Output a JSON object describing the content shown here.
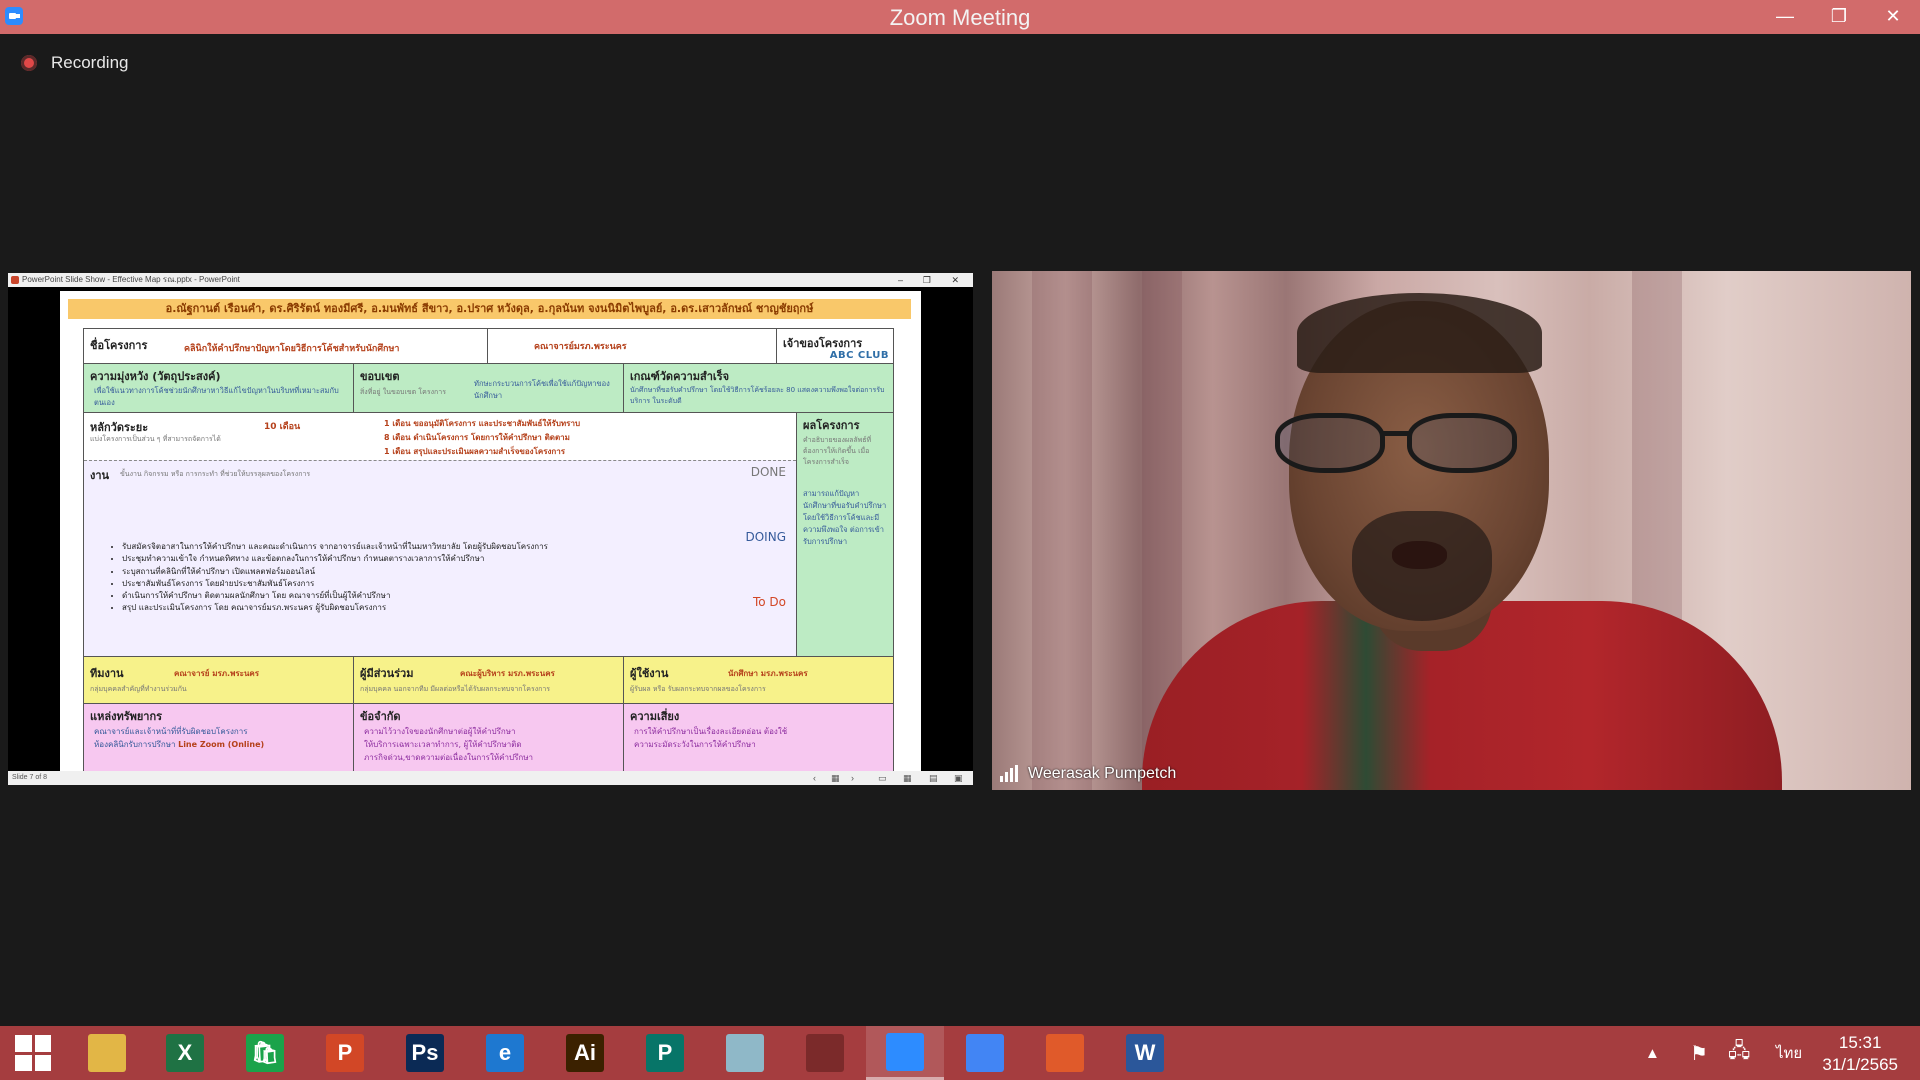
{
  "window": {
    "title": "Zoom Meeting",
    "controls": {
      "minimize": "—",
      "maximize": "❐",
      "close": "✕"
    },
    "brand_color": "#d26b6b"
  },
  "recording": {
    "label": "Recording"
  },
  "share": {
    "powerpoint_title": "PowerPoint Slide Show - Effective Map รณ.pptx - PowerPoint",
    "status_left": "Slide 7 of 8",
    "slide": {
      "header": "อ.ณัฐกานต์ เรือนคำ, ดร.ศิริรัตน์ ทองมีศรี, อ.มนพัทธ์ สีขาว, อ.ปราศ หวังดุล, อ.กุลนันท จงนนิมิตไพบูลย์, อ.ดร.เสาวลักษณ์ ชาญชัยฤกษ์",
      "project_name": {
        "label": "ชื่อโครงการ",
        "value": "คลินิกให้คำปรึกษาปัญหาโดยวิธีการโค้ชสำหรับนักศึกษา"
      },
      "owner_value": "คณาจารย์มรภ.พระนคร",
      "project_owner": {
        "label": "เจ้าของโครงการ",
        "logo": "ABC CLUB"
      },
      "objective": {
        "label": "ความมุ่งหวัง (วัตถุประสงค์)",
        "text": "เพื่อใช้แนวทางการโค้ชช่วยนักศึกษาหาวิธีแก้ไขปัญหาในบริบทที่เหมาะสมกับตนเอง"
      },
      "scope": {
        "label": "ขอบเขต",
        "sub": "สิ่งที่อยู่ ในขอบเขต โครงการ",
        "text": "ทักษะกระบวนการโค้ชเพื่อใช้แก้ปัญหาของนักศึกษา"
      },
      "success_criteria": {
        "label": "เกณฑ์วัดความสำเร็จ",
        "text": "นักศึกษาที่ขอรับคำปรึกษา โดยใช้วิธีการโค้ชร้อยละ 80 แสดงความพึงพอใจต่อการรับบริการ ในระดับดี"
      },
      "milestones": {
        "label": "หลักวัดระยะ",
        "sub": "แบ่งโครงการเป็นส่วน ๆ ที่สามารถจัดการได้",
        "duration": "10 เดือน",
        "items": [
          "1 เดือน ขออนุมัติโครงการ และประชาสัมพันธ์ให้รับทราบ",
          "8 เดือน ดำเนินโครงการ โดยการให้คำปรึกษา ติดตาม",
          "1 เดือน สรุปและประเมินผลความสำเร็จของโครงการ"
        ]
      },
      "tasks": {
        "label": "งาน",
        "sub": "ขั้นงาน กิจกรรม หรือ การกระทำ ที่ช่วยให้บรรลุผลของโครงการ",
        "done": "DONE",
        "doing": "DOING",
        "todo": "To Do",
        "bullets": [
          "รับสมัครจิตอาสาในการให้คำปรึกษา และคณะดำเนินการ จากอาจารย์และเจ้าหน้าที่ในมหาวิทยาลัย โดยผู้รับผิดชอบโครงการ",
          "ประชุมทำความเข้าใจ กำหนดทิศทาง และข้อตกลงในการให้คำปรึกษา กำหนดตารางเวลาการให้คำปรึกษา",
          "ระบุสถานที่คลินิกที่ให้คำปรึกษา เปิดแพลตฟอร์มออนไลน์",
          "ประชาสัมพันธ์โครงการ โดยฝ่ายประชาสัมพันธ์โครงการ",
          "ดำเนินการให้คำปรึกษา ติดตามผลนักศึกษา โดย คณาจารย์ที่เป็นผู้ให้คำปรึกษา",
          "สรุป และประเมินโครงการ โดย คณาจารย์มรภ.พระนคร ผู้รับผิดชอบโครงการ"
        ]
      },
      "outcome": {
        "label": "ผลโครงการ",
        "sub": "คำอธิบายของผลลัพธ์ที่ต้องการให้เกิดขึ้น เมื่อโครงการสำเร็จ",
        "text": "สามารถแก้ปัญหานักศึกษาที่ขอรับคำปรึกษา โดยใช้วิธีการโค้ชและมีความพึงพอใจ ต่อการเข้ารับการปรึกษา"
      },
      "team": {
        "label": "ทีมงาน",
        "value": "คณาจารย์ มรภ.พระนคร",
        "sub": "กลุ่มบุคคลสำคัญที่ทำงานร่วมกัน"
      },
      "stakeholders": {
        "label": "ผู้มีส่วนร่วม",
        "value": "คณะผู้บริหาร มรภ.พระนคร",
        "sub": "กลุ่มบุคคล นอกจากทีม มีผลต่อหรือได้รับผลกระทบจากโครงการ"
      },
      "users": {
        "label": "ผู้ใช้งาน",
        "value": "นักศึกษา มรภ.พระนคร",
        "sub": "ผู้รับผล หรือ รับผลกระทบจากผลของโครงการ"
      },
      "resources": {
        "label": "แหล่งทรัพยากร",
        "text1": "คณาจารย์และเจ้าหน้าที่ที่รับผิดชอบโครงการ",
        "text2": "ห้องคลินิกรับการปรึกษา",
        "text3": "Line Zoom (Online)"
      },
      "constraints": {
        "label": "ข้อจำกัด",
        "text1": "ความไว้วางใจของนักศึกษาต่อผู้ให้คำปรึกษา",
        "text2": "ให้บริการเฉพาะเวลาทำการ, ผู้ให้คำปรึกษาติด",
        "text3": "ภารกิจด่วน,ขาดความต่อเนื่องในการให้คำปรึกษา"
      },
      "risks": {
        "label": "ความเสี่ยง",
        "text1": "การให้คำปรึกษาเป็นเรื่องละเอียดอ่อน ต้องใช้",
        "text2": "ความระมัดระวังในการให้คำปรึกษา"
      }
    }
  },
  "participant": {
    "name": "Weerasak Pumpetch"
  },
  "taskbar": {
    "apps": [
      {
        "name": "file-explorer-icon",
        "glyph": "",
        "color": "#e2b646"
      },
      {
        "name": "excel-icon",
        "glyph": "X",
        "color": "#1f7244"
      },
      {
        "name": "store-icon",
        "glyph": "🛍",
        "color": "#1aa34a"
      },
      {
        "name": "powerpoint-icon",
        "glyph": "P",
        "color": "#d24726"
      },
      {
        "name": "photoshop-icon",
        "glyph": "Ps",
        "color": "#0b2a55"
      },
      {
        "name": "internet-explorer-icon",
        "glyph": "e",
        "color": "#1e78d0"
      },
      {
        "name": "illustrator-icon",
        "glyph": "Ai",
        "color": "#3b2100"
      },
      {
        "name": "publisher-icon",
        "glyph": "P",
        "color": "#077568"
      },
      {
        "name": "notepad-icon",
        "glyph": "",
        "color": "#8fb8c8"
      },
      {
        "name": "hotocape-icon",
        "glyph": "",
        "color": "#7b2a2a"
      },
      {
        "name": "zoom-icon",
        "glyph": "",
        "color": "#2d8cff"
      },
      {
        "name": "chrome-icon",
        "glyph": "",
        "color": "#4285f4"
      },
      {
        "name": "photos-icon",
        "glyph": "",
        "color": "#e05a2a"
      },
      {
        "name": "word-icon",
        "glyph": "W",
        "color": "#2b579a"
      }
    ],
    "language": "ไทย",
    "time": "15:31",
    "date": "31/1/2565"
  }
}
